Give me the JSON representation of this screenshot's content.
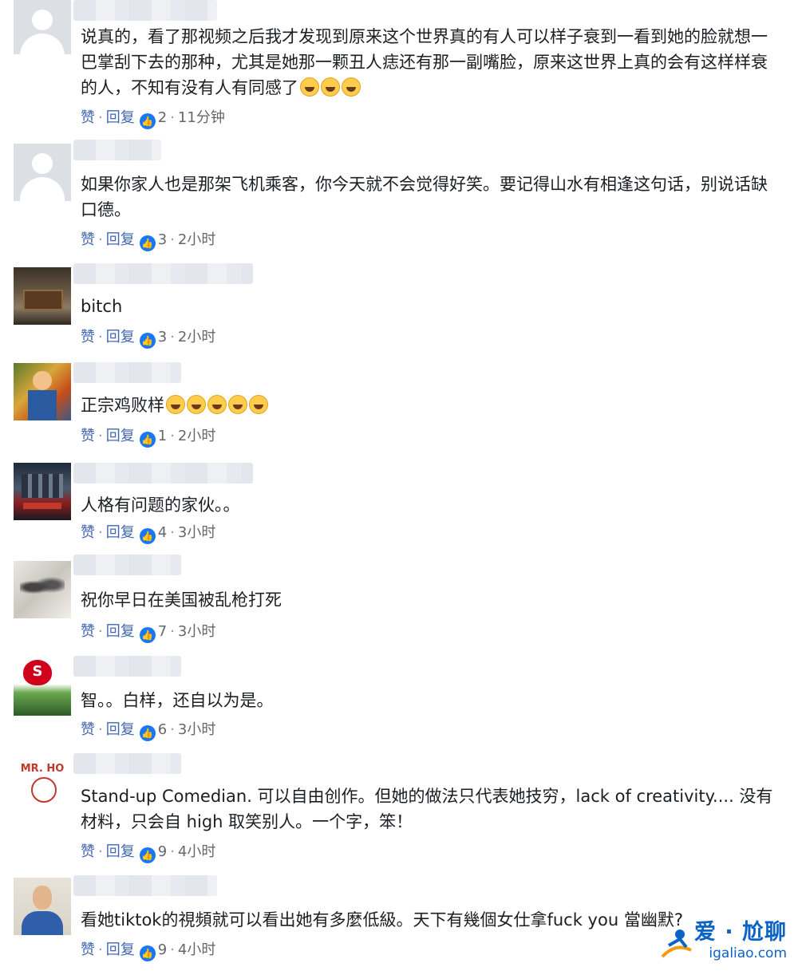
{
  "colors": {
    "link": "#4267b2",
    "like_badge": "#1877f2",
    "meta": "#65676b",
    "text": "#1c1e21",
    "watermark": "#0b63c8"
  },
  "comments": [
    {
      "avatar": "default-avatar",
      "text": "说真的，看了那视频之后我才发现到原来这个世界真的有人可以样子衰到一看到她的脸就想一巴掌刮下去的那种，尤其是她那一颗丑人痣还有那一副嘴脸，原来这世界上真的会有这样样衰的人，不知有没有人有同感了",
      "emoji_count": 3,
      "like": "赞",
      "reply": "回复",
      "reactions": "2",
      "time": "11分钟"
    },
    {
      "avatar": "default-avatar",
      "text": "如果你家人也是那架飞机乘客，你今天就不会觉得好笑。要记得山水有相逢这句话，别说话缺口德。",
      "like": "赞",
      "reply": "回复",
      "reactions": "3",
      "time": "2小时"
    },
    {
      "avatar": "room-photo-avatar",
      "text": "bitch",
      "like": "赞",
      "reply": "回复",
      "reactions": "3",
      "time": "2小时"
    },
    {
      "avatar": "cartoon-avatar",
      "text": "正宗鸡败样",
      "emoji_count": 5,
      "like": "赞",
      "reply": "回复",
      "reactions": "1",
      "time": "2小时"
    },
    {
      "avatar": "movie-poster-avatar",
      "text": "人格有问题的家伙。。",
      "like": "赞",
      "reply": "回复",
      "reactions": "4",
      "time": "3小时"
    },
    {
      "avatar": "horse-painting-avatar",
      "text": "祝你早日在美国被乱枪打死",
      "like": "赞",
      "reply": "回复",
      "reactions": "7",
      "time": "3小时"
    },
    {
      "avatar": "heart-landscape-avatar",
      "text": "智。。白样，还自以为是。",
      "like": "赞",
      "reply": "回复",
      "reactions": "6",
      "time": "3小时"
    },
    {
      "avatar": "mr-ho-logo-avatar",
      "avatar_text": "MR. HO",
      "text": "Stand-up Comedian. 可以自由创作。但她的做法只代表她技穷，lack of creativity.... 没有材料，只会自 high 取笑别人。一个字，笨！",
      "like": "赞",
      "reply": "回复",
      "reactions": "9",
      "time": "4小时"
    },
    {
      "avatar": "man-portrait-avatar",
      "text": "看她tiktok的視頻就可以看出她有多麼低級。天下有幾個女仕拿fuck you 當幽默?",
      "like": "赞",
      "reply": "回复",
      "reactions": "9",
      "time": "4小时"
    }
  ],
  "watermark": {
    "title": "爱 · 尬聊",
    "url": "igaliao.com"
  }
}
